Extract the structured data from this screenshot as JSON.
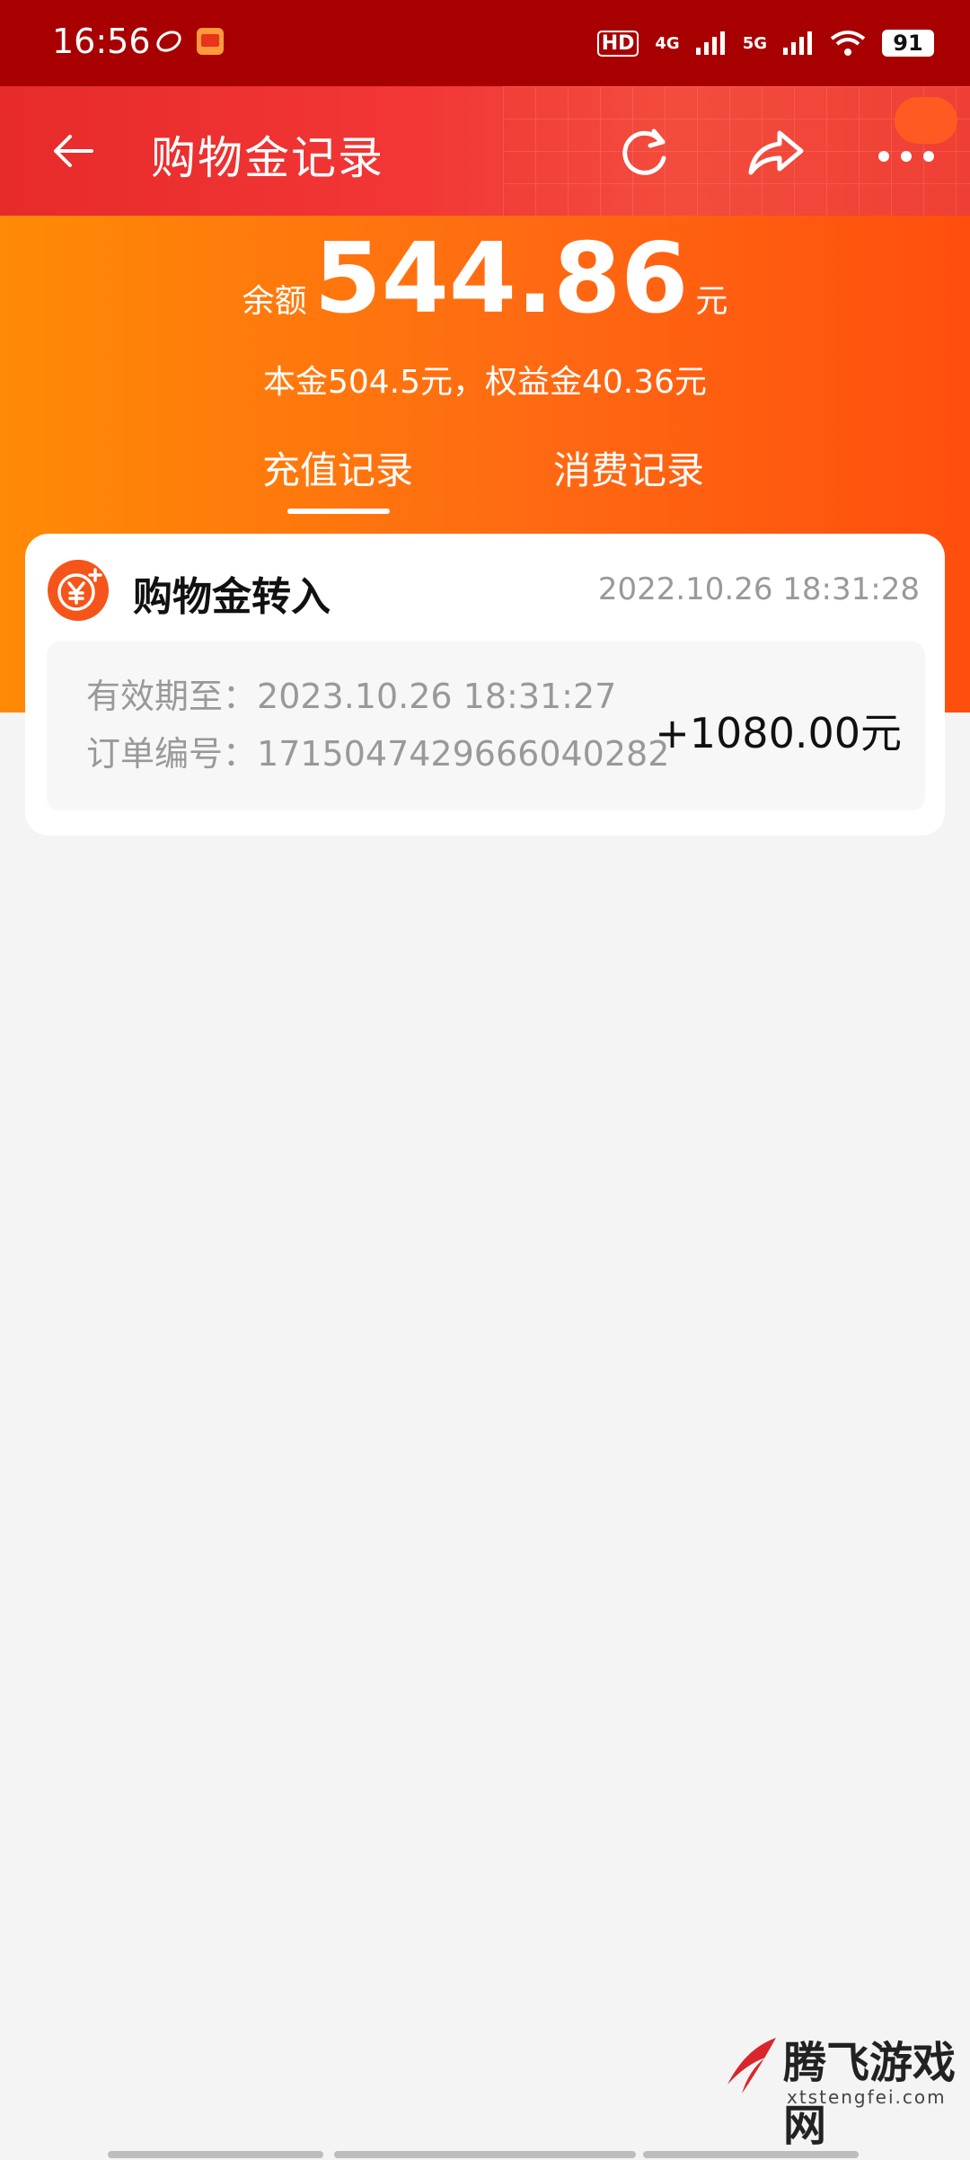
{
  "status_bar": {
    "time": "16:56",
    "network_1": "4G",
    "network_2": "5G",
    "hd_label": "HD",
    "battery": "91"
  },
  "header": {
    "title": "购物金记录"
  },
  "balance": {
    "label": "余额",
    "value": "544.86",
    "unit": "元",
    "detail": "本金504.5元，权益金40.36元"
  },
  "tabs": [
    {
      "label": "充值记录",
      "active": true
    },
    {
      "label": "消费记录",
      "active": false
    }
  ],
  "records": [
    {
      "title": "购物金转入",
      "time": "2022.10.26 18:31:28",
      "expire_label": "有效期至：",
      "expire_value": "2023.10.26 18:31:27",
      "order_label": "订单编号：",
      "order_value": "1715047429666040282",
      "amount": "+1080.00元"
    }
  ],
  "watermark": {
    "name": "腾飞游戏网",
    "url": "xtstengfei.com"
  },
  "colors": {
    "status_bar": "#a80000",
    "header": "#ef3232",
    "summary_start": "#ff8a05",
    "summary_end": "#ff4e0e",
    "accent_icon": "#f5551a"
  }
}
